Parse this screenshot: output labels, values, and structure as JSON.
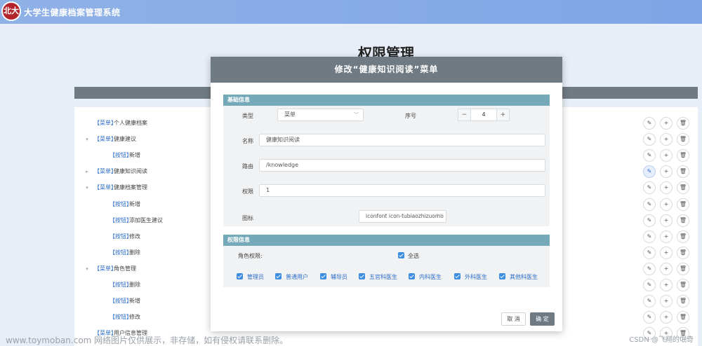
{
  "header": {
    "app_title": "大学生健康档案管理系统",
    "logo_text": "北大"
  },
  "page": {
    "title": "权限管理"
  },
  "tree": [
    {
      "tag": "【菜单】",
      "label": "个人健康档案",
      "level": 0,
      "caret": ""
    },
    {
      "tag": "【菜单】",
      "label": "健康建议",
      "level": 0,
      "caret": "▾"
    },
    {
      "tag": "【按钮】",
      "label": "新增",
      "level": 1,
      "caret": ""
    },
    {
      "tag": "【菜单】",
      "label": "健康知识阅读",
      "level": 0,
      "caret": "▸"
    },
    {
      "tag": "【菜单】",
      "label": "健康档案管理",
      "level": 0,
      "caret": "▾"
    },
    {
      "tag": "【按钮】",
      "label": "新增",
      "level": 1,
      "caret": ""
    },
    {
      "tag": "【按钮】",
      "label": "添加医生建议",
      "level": 1,
      "caret": ""
    },
    {
      "tag": "【按钮】",
      "label": "修改",
      "level": 1,
      "caret": ""
    },
    {
      "tag": "【按钮】",
      "label": "删除",
      "level": 1,
      "caret": ""
    },
    {
      "tag": "【菜单】",
      "label": "角色管理",
      "level": 0,
      "caret": "▾"
    },
    {
      "tag": "【按钮】",
      "label": "删除",
      "level": 1,
      "caret": ""
    },
    {
      "tag": "【按钮】",
      "label": "新增",
      "level": 1,
      "caret": ""
    },
    {
      "tag": "【按钮】",
      "label": "修改",
      "level": 1,
      "caret": ""
    },
    {
      "tag": "【菜单】",
      "label": "用户信息管理",
      "level": 0,
      "caret": ""
    }
  ],
  "row_icons": {
    "edit": "✎",
    "add": "+",
    "delete": "🗑"
  },
  "dialog": {
    "title": "修改“健康知识阅读”菜单",
    "basic": {
      "header": "基础信息",
      "type_label": "类型",
      "type_value": "菜单",
      "order_label": "序号",
      "order_value": "4",
      "name_label": "名称",
      "name_value": "健康知识阅读",
      "route_label": "路由",
      "route_value": "/knowledge",
      "perm_label": "权限",
      "perm_value": "1",
      "icon_label": "图标",
      "icon_value": "iconfont icon-tubiaozhizuomo"
    },
    "permission": {
      "header": "权限信息",
      "role_label": "角色权限:",
      "select_all": "全选",
      "roles": [
        "管理员",
        "普通用户",
        "辅导员",
        "五官科医生",
        "内科医生",
        "外科医生",
        "其他科医生"
      ]
    },
    "cancel": "取 消",
    "confirm": "确 定"
  },
  "watermark": {
    "left": "www.toymoban.com 网络图片仅供展示，非存储，如有侵权请联系删除。",
    "right": "CSDN @飞翔的氓奇"
  }
}
